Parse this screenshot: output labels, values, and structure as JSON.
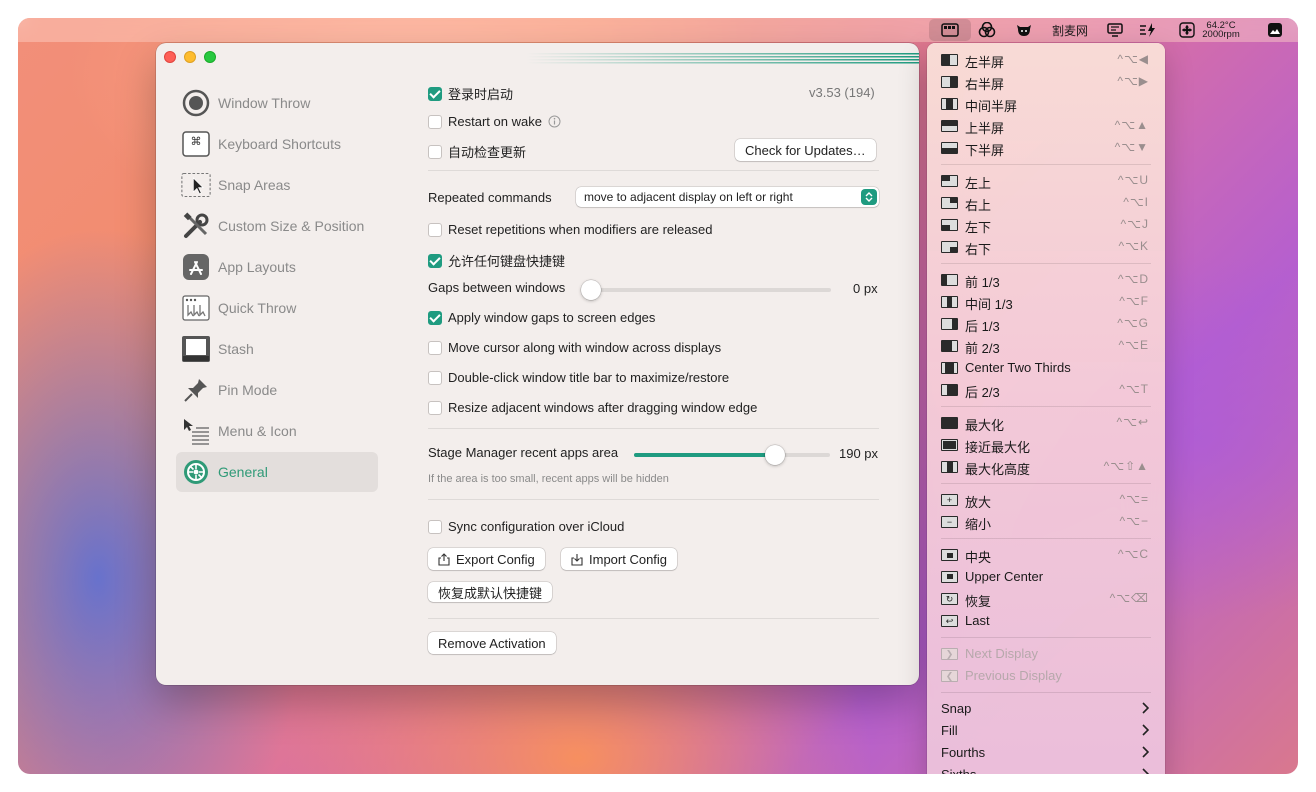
{
  "menubar": {
    "app_label": "割麦网",
    "temperature": "64.2°C",
    "fan_speed": "2000rpm"
  },
  "sidebar": {
    "items": [
      {
        "label": "Window Throw",
        "icon": "target-icon"
      },
      {
        "label": "Keyboard Shortcuts",
        "icon": "command-key-icon"
      },
      {
        "label": "Snap Areas",
        "icon": "cursor-area-icon"
      },
      {
        "label": "Custom Size & Position",
        "icon": "tools-icon"
      },
      {
        "label": "App Layouts",
        "icon": "app-store-icon"
      },
      {
        "label": "Quick Throw",
        "icon": "quick-throw-icon"
      },
      {
        "label": "Stash",
        "icon": "stash-icon"
      },
      {
        "label": "Pin Mode",
        "icon": "pin-icon"
      },
      {
        "label": "Menu & Icon",
        "icon": "menu-list-icon"
      },
      {
        "label": "General",
        "icon": "gear-icon",
        "selected": true
      }
    ]
  },
  "general": {
    "launch_at_login": {
      "label": "登录时启动",
      "checked": true
    },
    "version": "v3.53 (194)",
    "restart_on_wake": {
      "label": "Restart on wake",
      "checked": false
    },
    "auto_check_updates": {
      "label": "自动检查更新",
      "checked": false
    },
    "check_updates_button": "Check for Updates…",
    "repeated_commands": {
      "label": "Repeated commands",
      "value": "move to adjacent display on left or right"
    },
    "reset_repetitions": {
      "label": "Reset repetitions when modifiers are released",
      "checked": false
    },
    "allow_any_shortcut": {
      "label": "允许任何键盘快捷键",
      "checked": true
    },
    "gaps": {
      "label": "Gaps between windows",
      "value": "0 px",
      "fraction": 0.0
    },
    "apply_gaps_edges": {
      "label": "Apply window gaps to screen edges",
      "checked": true
    },
    "move_cursor": {
      "label": "Move cursor along with window across displays",
      "checked": false
    },
    "double_click_title": {
      "label": "Double-click window title bar to maximize/restore",
      "checked": false
    },
    "resize_adjacent": {
      "label": "Resize adjacent windows after dragging window edge",
      "checked": false
    },
    "stage_manager": {
      "label": "Stage Manager recent apps area",
      "value": "190 px",
      "fraction": 0.72,
      "hint": "If the area is too small, recent apps will be hidden"
    },
    "sync_icloud": {
      "label": "Sync configuration over iCloud",
      "checked": false
    },
    "export_button": "Export Config",
    "import_button": "Import Config",
    "restore_button": "恢复成默认快捷键",
    "remove_activation_button": "Remove Activation"
  },
  "menu": {
    "groups": [
      [
        {
          "label": "左半屏",
          "shortcut": "^⌥◀"
        },
        {
          "label": "右半屏",
          "shortcut": "^⌥▶"
        },
        {
          "label": "中间半屏",
          "shortcut": ""
        },
        {
          "label": "上半屏",
          "shortcut": "^⌥▲"
        },
        {
          "label": "下半屏",
          "shortcut": "^⌥▼"
        }
      ],
      [
        {
          "label": "左上",
          "shortcut": "^⌥U"
        },
        {
          "label": "右上",
          "shortcut": "^⌥I"
        },
        {
          "label": "左下",
          "shortcut": "^⌥J"
        },
        {
          "label": "右下",
          "shortcut": "^⌥K"
        }
      ],
      [
        {
          "label": "前 1/3",
          "shortcut": "^⌥D"
        },
        {
          "label": "中间 1/3",
          "shortcut": "^⌥F"
        },
        {
          "label": "后 1/3",
          "shortcut": "^⌥G"
        },
        {
          "label": "前 2/3",
          "shortcut": "^⌥E"
        },
        {
          "label": "Center Two Thirds",
          "shortcut": ""
        },
        {
          "label": "后 2/3",
          "shortcut": "^⌥T"
        }
      ],
      [
        {
          "label": "最大化",
          "shortcut": "^⌥↩"
        },
        {
          "label": "接近最大化",
          "shortcut": ""
        },
        {
          "label": "最大化高度",
          "shortcut": "^⌥⇧▲"
        }
      ],
      [
        {
          "label": "放大",
          "shortcut": "^⌥="
        },
        {
          "label": "缩小",
          "shortcut": "^⌥−"
        }
      ],
      [
        {
          "label": "中央",
          "shortcut": "^⌥C"
        },
        {
          "label": "Upper Center",
          "shortcut": ""
        },
        {
          "label": "恢复",
          "shortcut": "^⌥⌫"
        },
        {
          "label": "Last",
          "shortcut": ""
        }
      ],
      [
        {
          "label": "Next Display",
          "shortcut": "",
          "disabled": true
        },
        {
          "label": "Previous Display",
          "shortcut": "",
          "disabled": true
        }
      ]
    ],
    "submenus": [
      "Snap",
      "Fill",
      "Fourths",
      "Sixths"
    ]
  }
}
